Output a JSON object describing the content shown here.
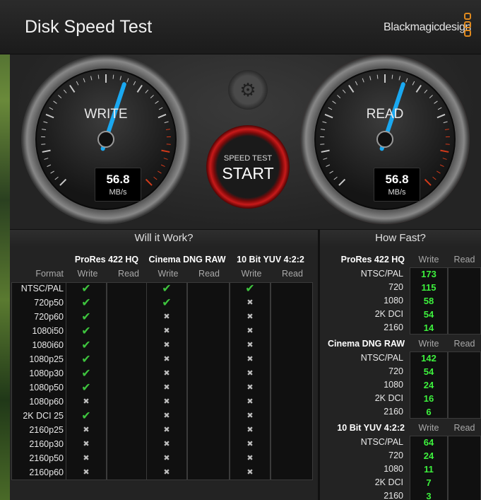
{
  "app": {
    "title": "Disk Speed Test",
    "brand": "Blackmagicdesign"
  },
  "gauges": {
    "write": {
      "label": "WRITE",
      "value": "56.8",
      "unit": "MB/s"
    },
    "read": {
      "label": "READ",
      "value": "56.8",
      "unit": "MB/s"
    }
  },
  "start_button": {
    "line1": "SPEED TEST",
    "line2": "START"
  },
  "will_it_work": {
    "title": "Will it Work?",
    "format_label": "Format",
    "codecs": [
      "ProRes 422 HQ",
      "Cinema DNG RAW",
      "10 Bit YUV 4:2:2"
    ],
    "write_label": "Write",
    "read_label": "Read",
    "rows": [
      {
        "format": "NTSC/PAL",
        "marks": [
          "check",
          "check",
          "check"
        ]
      },
      {
        "format": "720p50",
        "marks": [
          "check",
          "check",
          "cross"
        ]
      },
      {
        "format": "720p60",
        "marks": [
          "check",
          "cross",
          "cross"
        ]
      },
      {
        "format": "1080i50",
        "marks": [
          "check",
          "cross",
          "cross"
        ]
      },
      {
        "format": "1080i60",
        "marks": [
          "check",
          "cross",
          "cross"
        ]
      },
      {
        "format": "1080p25",
        "marks": [
          "check",
          "cross",
          "cross"
        ]
      },
      {
        "format": "1080p30",
        "marks": [
          "check",
          "cross",
          "cross"
        ]
      },
      {
        "format": "1080p50",
        "marks": [
          "check",
          "cross",
          "cross"
        ]
      },
      {
        "format": "1080p60",
        "marks": [
          "cross",
          "cross",
          "cross"
        ]
      },
      {
        "format": "2K DCI 25",
        "marks": [
          "check",
          "cross",
          "cross"
        ]
      },
      {
        "format": "2160p25",
        "marks": [
          "cross",
          "cross",
          "cross"
        ]
      },
      {
        "format": "2160p30",
        "marks": [
          "cross",
          "cross",
          "cross"
        ]
      },
      {
        "format": "2160p50",
        "marks": [
          "cross",
          "cross",
          "cross"
        ]
      },
      {
        "format": "2160p60",
        "marks": [
          "cross",
          "cross",
          "cross"
        ]
      }
    ]
  },
  "how_fast": {
    "title": "How Fast?",
    "write_label": "Write",
    "read_label": "Read",
    "groups": [
      {
        "name": "ProRes 422 HQ",
        "rows": [
          {
            "res": "NTSC/PAL",
            "write": "173",
            "read": ""
          },
          {
            "res": "720",
            "write": "115",
            "read": ""
          },
          {
            "res": "1080",
            "write": "58",
            "read": ""
          },
          {
            "res": "2K DCI",
            "write": "54",
            "read": ""
          },
          {
            "res": "2160",
            "write": "14",
            "read": ""
          }
        ]
      },
      {
        "name": "Cinema DNG RAW",
        "rows": [
          {
            "res": "NTSC/PAL",
            "write": "142",
            "read": ""
          },
          {
            "res": "720",
            "write": "54",
            "read": ""
          },
          {
            "res": "1080",
            "write": "24",
            "read": ""
          },
          {
            "res": "2K DCI",
            "write": "16",
            "read": ""
          },
          {
            "res": "2160",
            "write": "6",
            "read": ""
          }
        ]
      },
      {
        "name": "10 Bit YUV 4:2:2",
        "rows": [
          {
            "res": "NTSC/PAL",
            "write": "64",
            "read": ""
          },
          {
            "res": "720",
            "write": "24",
            "read": ""
          },
          {
            "res": "1080",
            "write": "11",
            "read": ""
          },
          {
            "res": "2K DCI",
            "write": "7",
            "read": ""
          },
          {
            "res": "2160",
            "write": "3",
            "read": ""
          }
        ]
      }
    ]
  },
  "icons": {
    "check": "check-icon",
    "cross": "cross-icon",
    "settings": "gear-icon"
  },
  "colors": {
    "needle": "#1aa8f0",
    "check": "#3ec43e",
    "number": "#3df03d",
    "logo": "#e08a1e",
    "read_rim": "#b01010"
  }
}
